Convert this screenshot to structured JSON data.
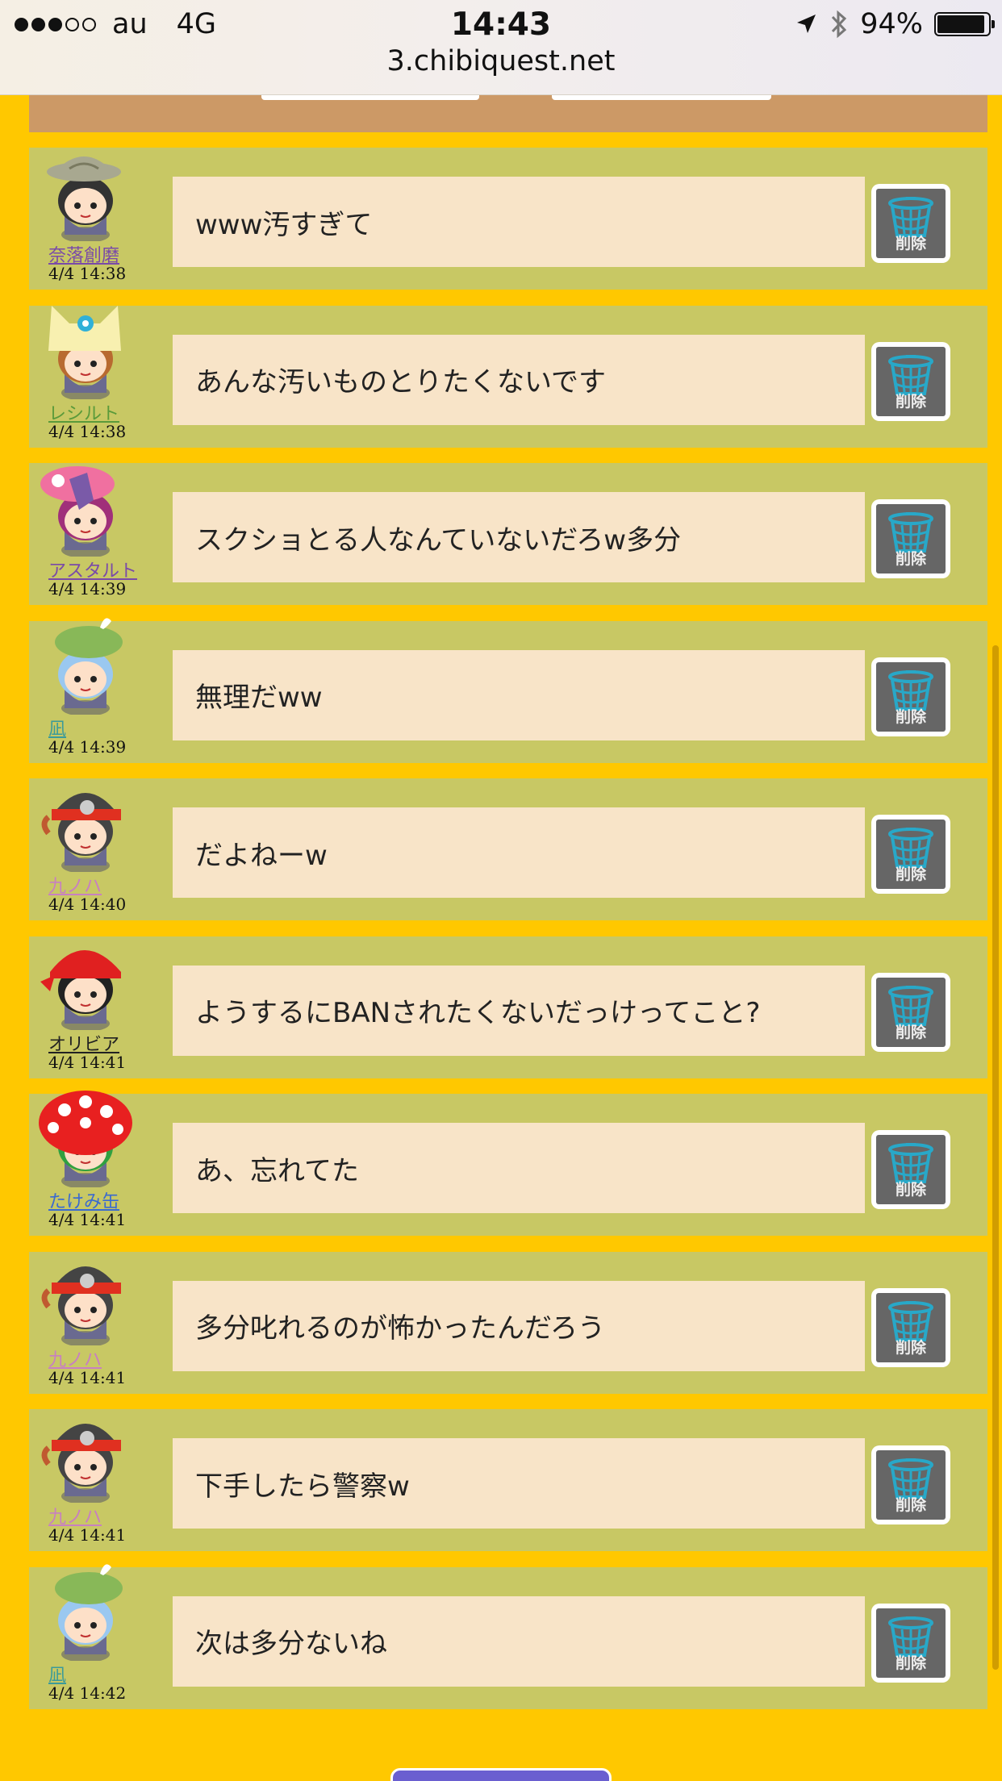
{
  "status_bar": {
    "carrier": "au",
    "network": "4G",
    "time": "14:43",
    "battery": "94%",
    "battery_level": 0.94,
    "url": "3.chibiquest.net"
  },
  "messages": [
    {
      "name": "奈落創磨",
      "time": "4/4 14:38",
      "text": "www汚すぎて",
      "name_color": "#7a4aa8",
      "delete_label": "削除"
    },
    {
      "name": "レシルト",
      "time": "4/4 14:38",
      "text": "あんな汚いものとりたくないです",
      "name_color": "#5a9a3a",
      "delete_label": "削除"
    },
    {
      "name": "アスタルト",
      "time": "4/4 14:39",
      "text": "スクショとる人なんていないだろw多分",
      "name_color": "#7a4aa8",
      "delete_label": "削除"
    },
    {
      "name": "凪",
      "time": "4/4 14:39",
      "text": "無理だww",
      "name_color": "#3a9a9a",
      "delete_label": "削除"
    },
    {
      "name": "九ノハ",
      "time": "4/4 14:40",
      "text": "だよねーw",
      "name_color": "#c880c0",
      "delete_label": "削除"
    },
    {
      "name": "オリビア",
      "time": "4/4 14:41",
      "text": "ようするにBANされたくないだっけってこと?",
      "name_color": "#222222",
      "delete_label": "削除"
    },
    {
      "name": "たけみ缶",
      "time": "4/4 14:41",
      "text": "あ、忘れてた",
      "name_color": "#3a6ad0",
      "delete_label": "削除"
    },
    {
      "name": "九ノハ",
      "time": "4/4 14:41",
      "text": "多分叱れるのが怖かったんだろう",
      "name_color": "#c880c0",
      "delete_label": "削除"
    },
    {
      "name": "九ノハ",
      "time": "4/4 14:41",
      "text": "下手したら警察w",
      "name_color": "#c880c0",
      "delete_label": "削除"
    },
    {
      "name": "凪",
      "time": "4/4 14:42",
      "text": "次は多分ないね",
      "name_color": "#3a9a9a",
      "delete_label": "削除"
    }
  ],
  "avatars": [
    {
      "icon": "explorer-hat-avatar-icon",
      "hat": "#a8a890",
      "hair": "#333333"
    },
    {
      "icon": "cat-hood-avatar-icon",
      "hat": "#f8f0b0",
      "hair": "#b86a30"
    },
    {
      "icon": "pink-hat-avatar-icon",
      "hat": "#f070a0",
      "hair": "#a0307a"
    },
    {
      "icon": "green-beret-avatar-icon",
      "hat": "#88b858",
      "hair": "#9ac8f0"
    },
    {
      "icon": "headband-avatar-icon",
      "hat": "#e03020",
      "hair": "#444444"
    },
    {
      "icon": "red-bandana-avatar-icon",
      "hat": "#e02020",
      "hair": "#222222"
    },
    {
      "icon": "mushroom-cap-avatar-icon",
      "hat": "#e82020",
      "hair": "#30a040"
    },
    {
      "icon": "headband-avatar-icon",
      "hat": "#e03020",
      "hair": "#444444"
    },
    {
      "icon": "headband-avatar-icon",
      "hat": "#e03020",
      "hair": "#444444"
    },
    {
      "icon": "green-beret-avatar-icon",
      "hat": "#88b858",
      "hair": "#9ac8f0"
    }
  ],
  "colors": {
    "page_bg": "#ffc800",
    "row_bg": "#c8c864",
    "bubble_bg": "#f8e4c8",
    "header_strip": "#cc9966",
    "delete_bg": "#666666",
    "trash_icon": "#28a8c8"
  }
}
